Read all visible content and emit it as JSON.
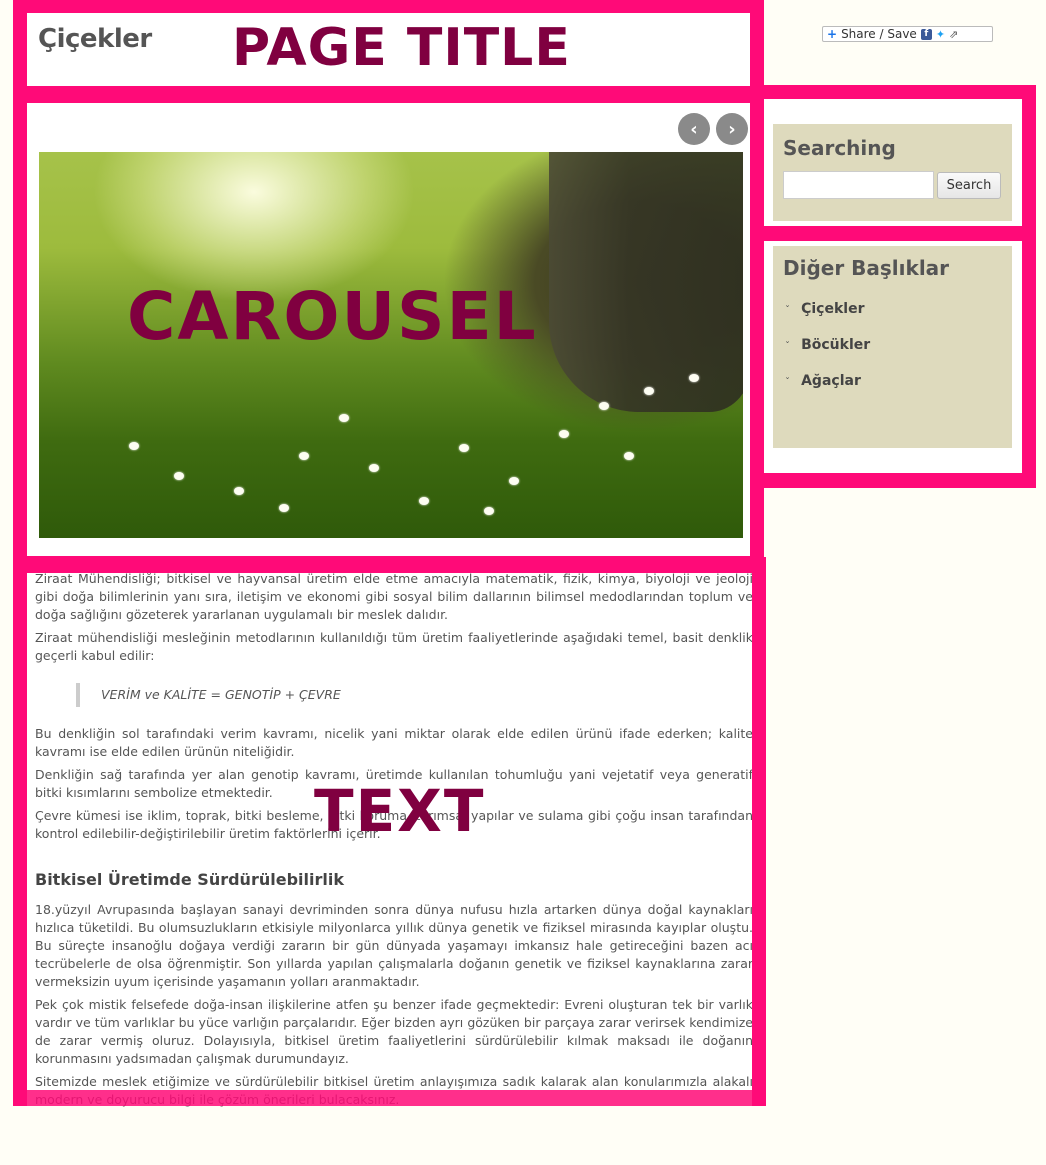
{
  "header": {
    "site_title": "Çiçekler",
    "overlay_label": "PAGE TITLE"
  },
  "share": {
    "label": "Share / Save",
    "icons": [
      "plus-icon",
      "facebook-icon",
      "twitter-icon",
      "share-arrow-icon"
    ]
  },
  "carousel": {
    "overlay_label": "CAROUSEL",
    "prev_icon": "chevron-left-icon",
    "next_icon": "chevron-right-icon",
    "prev_glyph": "‹",
    "next_glyph": "›"
  },
  "sidebar": {
    "search": {
      "title": "Searching",
      "input_value": "",
      "button_label": "Search"
    },
    "other": {
      "title": "Diğer Başlıklar",
      "bullet": "ˇ",
      "items": [
        {
          "label": "Çiçekler"
        },
        {
          "label": "Böcükler"
        },
        {
          "label": "Ağaçlar"
        }
      ]
    }
  },
  "content": {
    "overlay_label": "TEXT",
    "p1": "Ziraat Mühendisliği; bitkisel ve hayvansal üretim elde etme amacıyla matematik, fizik, kimya, biyoloji ve  jeoloji gibi doğa bilimlerinin yanı sıra, iletişim ve ekonomi gibi sosyal bilim dallarının bilimsel medodlarından toplum ve doğa sağlığını gözeterek yararlanan uygulamalı bir meslek dalıdır.",
    "p2": "Ziraat mühendisliği mesleğinin metodlarının kullanıldığı tüm üretim faaliyetlerinde aşağıdaki  temel, basit denklik geçerli kabul edilir:",
    "quote": "VERİM ve KALİTE = GENOTİP + ÇEVRE",
    "p3": "Bu denkliğin sol tarafındaki verim kavramı, nicelik yani miktar olarak elde edilen ürünü ifade ederken; kalite kavramı ise elde edilen ürünün niteliğidir.",
    "p4": "Denkliğin sağ tarafında yer alan genotip kavramı, üretimde kullanılan tohumluğu yani vejetatif veya generatif bitki kısımlarını sembolize etmektedir.",
    "p5": "Çevre kümesi ise iklim, toprak, bitki besleme, bitki koruma, tarımsal yapılar ve sulama gibi çoğu insan tarafından kontrol edilebilir-değiştirilebilir üretim faktörlerini içerir.",
    "heading": "Bitkisel Üretimde Sürdürülebilirlik",
    "p6": "18.yüzyıl Avrupasında başlayan sanayi devriminden sonra dünya nufusu hızla artarken dünya doğal kaynakları hızlıca tüketildi. Bu olumsuzlukların  etkisiyle milyonlarca yıllık dünya genetik ve fiziksel mirasında kayıplar oluştu. Bu süreçte insanoğlu doğaya verdiği zararın bir gün dünyada yaşamayı imkansız hale getireceğini bazen acı tecrübelerle de olsa öğrenmiştir. Son yıllarda yapılan çalışmalarla doğanın genetik ve fiziksel kaynaklarına zarar vermeksizin uyum içerisinde yaşamanın yolları aranmaktadır.",
    "p7": "Pek çok mistik felsefede doğa-insan ilişkilerine atfen şu benzer ifade geçmektedir: Evreni oluşturan tek bir varlık vardır ve tüm varlıklar bu yüce varlığın parçalarıdır. Eğer bizden ayrı gözüken bir parçaya zarar verirsek kendimize de zarar vermiş oluruz. Dolayısıyla, bitkisel üretim faaliyetlerini sürdürülebilir kılmak maksadı ile doğanın korunmasını yadsımadan çalışmak durumundayız.",
    "p8": "Sitemizde meslek etiğimize ve sürdürülebilir bitkisel üretim anlayışımıza sadık kalarak  alan konularımızla alakalı modern ve doyurucu bilgi ile çözüm önerileri bulacaksınız."
  },
  "colors": {
    "frame": "#ff0a78",
    "overlay_text": "#800040",
    "widget_bg": "#dedabd",
    "page_bg": "#fffef6"
  }
}
